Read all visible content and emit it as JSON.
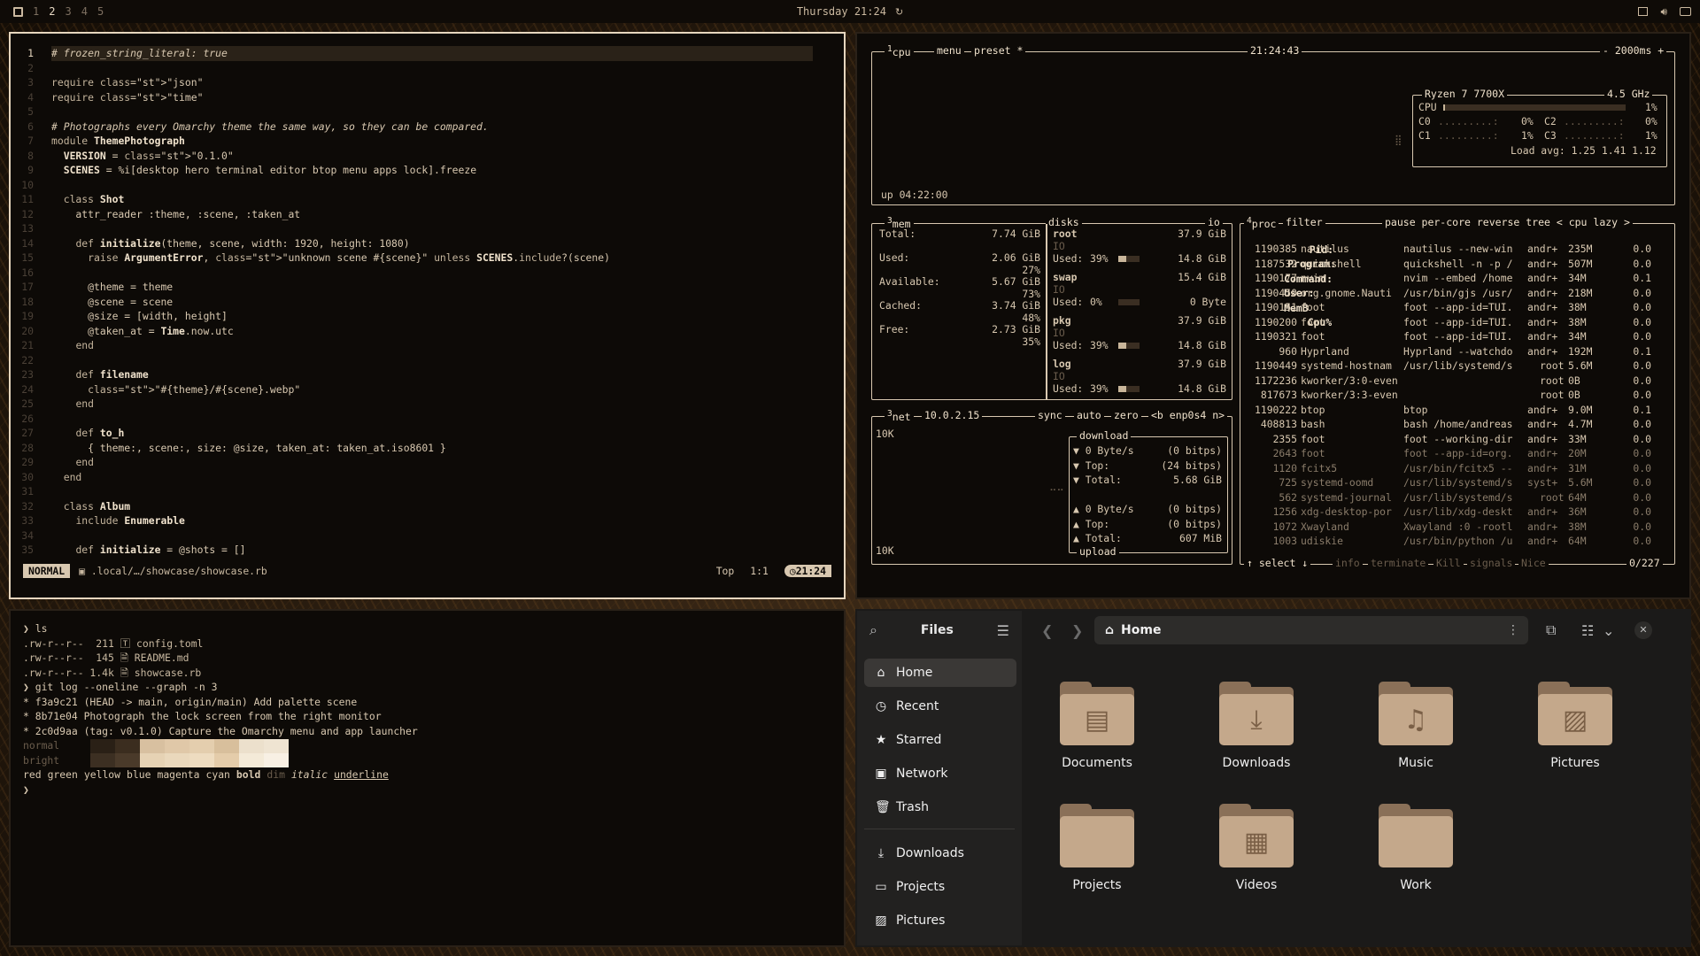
{
  "topbar": {
    "workspaces": [
      "1",
      "2",
      "3",
      "4",
      "5"
    ],
    "active_workspace": "2",
    "clock": "Thursday 21:24",
    "menu_icon": "omarchy-logo-icon",
    "right_icons": [
      "screen-icon",
      "volume-icon",
      "battery-icon"
    ]
  },
  "editor": {
    "lines": [
      {
        "n": "1",
        "t": "# frozen_string_literal: true"
      },
      {
        "n": "2",
        "t": ""
      },
      {
        "n": "3",
        "t": "require \"json\""
      },
      {
        "n": "4",
        "t": "require \"time\""
      },
      {
        "n": "5",
        "t": ""
      },
      {
        "n": "6",
        "t": "# Photographs every Omarchy theme the same way, so they can be compared."
      },
      {
        "n": "7",
        "t": "module ThemePhotograph"
      },
      {
        "n": "8",
        "t": "  VERSION = \"0.1.0\""
      },
      {
        "n": "9",
        "t": "  SCENES = %i[desktop hero terminal editor btop menu apps lock].freeze"
      },
      {
        "n": "10",
        "t": ""
      },
      {
        "n": "11",
        "t": "  class Shot"
      },
      {
        "n": "12",
        "t": "    attr_reader :theme, :scene, :taken_at"
      },
      {
        "n": "13",
        "t": ""
      },
      {
        "n": "14",
        "t": "    def initialize(theme, scene, width: 1920, height: 1080)"
      },
      {
        "n": "15",
        "t": "      raise ArgumentError, \"unknown scene #{scene}\" unless SCENES.include?(scene)"
      },
      {
        "n": "16",
        "t": ""
      },
      {
        "n": "17",
        "t": "      @theme = theme"
      },
      {
        "n": "18",
        "t": "      @scene = scene"
      },
      {
        "n": "19",
        "t": "      @size = [width, height]"
      },
      {
        "n": "20",
        "t": "      @taken_at = Time.now.utc"
      },
      {
        "n": "21",
        "t": "    end"
      },
      {
        "n": "22",
        "t": ""
      },
      {
        "n": "23",
        "t": "    def filename"
      },
      {
        "n": "24",
        "t": "      \"#{theme}/#{scene}.webp\""
      },
      {
        "n": "25",
        "t": "    end"
      },
      {
        "n": "26",
        "t": ""
      },
      {
        "n": "27",
        "t": "    def to_h"
      },
      {
        "n": "28",
        "t": "      { theme:, scene:, size: @size, taken_at: taken_at.iso8601 }"
      },
      {
        "n": "29",
        "t": "    end"
      },
      {
        "n": "30",
        "t": "  end"
      },
      {
        "n": "31",
        "t": ""
      },
      {
        "n": "32",
        "t": "  class Album"
      },
      {
        "n": "33",
        "t": "    include Enumerable"
      },
      {
        "n": "34",
        "t": ""
      },
      {
        "n": "35",
        "t": "    def initialize = @shots = []"
      }
    ],
    "status": {
      "mode": "NORMAL",
      "file": ".local/…/showcase/showcase.rb",
      "position": "Top",
      "cursor": "1:1",
      "clock": "21:24"
    }
  },
  "btop": {
    "cpu": {
      "title": "cpu",
      "menu": "menu",
      "preset": "preset *",
      "time": "21:24:43",
      "interval": "- 2000ms +",
      "model": "Ryzen 7 7700X",
      "freq": "4.5 GHz",
      "total_label": "CPU",
      "total": "1%",
      "cores": [
        {
          "name": "C0",
          "val": "0%"
        },
        {
          "name": "C1",
          "val": "1%"
        },
        {
          "name": "C2",
          "val": "0%"
        },
        {
          "name": "C3",
          "val": "1%"
        }
      ],
      "load": "Load avg: 1.25 1.41 1.12",
      "uptime": "up 04:22:00"
    },
    "mem": {
      "title": "mem",
      "rows": [
        {
          "l": "Total:",
          "v": "7.74 GiB"
        },
        {
          "l": "Used:",
          "v": "2.06 GiB",
          "p": "27%"
        },
        {
          "l": "Available:",
          "v": "5.67 GiB",
          "p": "73%"
        },
        {
          "l": "Cached:",
          "v": "3.74 GiB",
          "p": "48%"
        },
        {
          "l": "Free:",
          "v": "2.73 GiB",
          "p": "35%"
        }
      ]
    },
    "disks": {
      "title": "disks",
      "io": "io",
      "items": [
        {
          "name": "root",
          "size": "37.9 GiB",
          "used_pct": "39%",
          "used": "14.8 GiB"
        },
        {
          "name": "swap",
          "size": "15.4 GiB",
          "used_pct": "0%",
          "used": "0 Byte"
        },
        {
          "name": "pkg",
          "size": "37.9 GiB",
          "used_pct": "39%",
          "used": "14.8 GiB"
        },
        {
          "name": "log",
          "size": "37.9 GiB",
          "used_pct": "39%",
          "used": "14.8 GiB"
        }
      ],
      "io_label": "IO",
      "used_label": "Used:"
    },
    "net": {
      "title": "net",
      "addr": "10.0.2.15",
      "sync": "sync",
      "auto": "auto",
      "zero": "zero",
      "iface": "<b enp0s4 n>",
      "scale_top": "10K",
      "scale_bottom": "10K",
      "download": "download",
      "upload": "upload",
      "down": [
        {
          "l": "▼ 0 Byte/s",
          "r": "(0 bitps)"
        },
        {
          "l": "▼ Top:",
          "r": "(24 bitps)"
        },
        {
          "l": "▼ Total:",
          "r": "5.68 GiB"
        }
      ],
      "up": [
        {
          "l": "▲ 0 Byte/s",
          "r": "(0 bitps)"
        },
        {
          "l": "▲ Top:",
          "r": "(0 bitps)"
        },
        {
          "l": "▲ Total:",
          "r": "607 MiB"
        }
      ]
    },
    "proc": {
      "title": "proc",
      "filter": "filter",
      "opts": "pause per-core reverse tree < cpu lazy >",
      "headers": {
        "pid": "Pid:",
        "program": "Program:",
        "command": "Command:",
        "user": "User:",
        "mem": "MemB",
        "cpu": "Cpu%"
      },
      "rows": [
        [
          "1190385",
          "nautilus",
          "nautilus --new-win",
          "andr+",
          "235M",
          "0.0"
        ],
        [
          "1187532",
          "quickshell",
          "quickshell -n -p /",
          "andr+",
          "507M",
          "0.0"
        ],
        [
          "1190177",
          "nvim",
          "nvim --embed /home",
          "andr+",
          "34M",
          "0.1"
        ],
        [
          "1190450",
          "org.gnome.Nauti",
          "/usr/bin/gjs /usr/",
          "andr+",
          "218M",
          "0.0"
        ],
        [
          "1190151",
          "foot",
          "foot --app-id=TUI.",
          "andr+",
          "38M",
          "0.0"
        ],
        [
          "1190200",
          "foot",
          "foot --app-id=TUI.",
          "andr+",
          "38M",
          "0.0"
        ],
        [
          "1190321",
          "foot",
          "foot --app-id=TUI.",
          "andr+",
          "34M",
          "0.0"
        ],
        [
          "960",
          "Hyprland",
          "Hyprland --watchdo",
          "andr+",
          "192M",
          "0.1"
        ],
        [
          "1190449",
          "systemd-hostnam",
          "/usr/lib/systemd/s",
          "root",
          "5.6M",
          "0.0"
        ],
        [
          "1172236",
          "kworker/3:0-even",
          "",
          "root",
          "0B",
          "0.0"
        ],
        [
          "817673",
          "kworker/3:3-even",
          "",
          "root",
          "0B",
          "0.0"
        ],
        [
          "1190222",
          "btop",
          "btop",
          "andr+",
          "9.0M",
          "0.1"
        ],
        [
          "408813",
          "bash",
          "bash /home/andreas",
          "andr+",
          "4.7M",
          "0.0"
        ],
        [
          "2355",
          "foot",
          "foot --working-dir",
          "andr+",
          "33M",
          "0.0"
        ],
        [
          "2643",
          "foot",
          "foot --app-id=org.",
          "andr+",
          "20M",
          "0.0"
        ],
        [
          "1120",
          "fcitx5",
          "/usr/bin/fcitx5 --",
          "andr+",
          "31M",
          "0.0"
        ],
        [
          "725",
          "systemd-oomd",
          "/usr/lib/systemd/s",
          "syst+",
          "5.6M",
          "0.0"
        ],
        [
          "562",
          "systemd-journal",
          "/usr/lib/systemd/s",
          "root",
          "64M",
          "0.0"
        ],
        [
          "1256",
          "xdg-desktop-por",
          "/usr/lib/xdg-deskt",
          "andr+",
          "36M",
          "0.0"
        ],
        [
          "1072",
          "Xwayland",
          "Xwayland :0 -rootl",
          "andr+",
          "38M",
          "0.0"
        ],
        [
          "1003",
          "udiskie",
          "/usr/bin/python /u",
          "andr+",
          "64M",
          "0.0"
        ]
      ],
      "footer": {
        "select": "↑ select ↓",
        "info": "info",
        "terminate": "terminate",
        "kill": "Kill",
        "signals": "signals",
        "nice": "Nice",
        "count": "0/227"
      }
    }
  },
  "terminal": {
    "lines": [
      "❯ ls",
      ".rw-r--r--  211 🅃 config.toml",
      ".rw-r--r--  145 🗎 README.md",
      ".rw-r--r-- 1.4k 🗎 showcase.rb",
      "❯ git log --oneline --graph -n 3",
      "* f3a9c21 (HEAD -> main, origin/main) Add palette scene",
      "* 8b71e04 Photograph the lock screen from the right monitor",
      "* 2c0d9aa (tag: v0.1.0) Capture the Omarchy menu and app launcher"
    ],
    "palette_normal": "normal",
    "palette_bright": "bright",
    "normal_colors": [
      "#2a2016",
      "#3b2d1f",
      "#d8c0a0",
      "#e0c8a8",
      "#e4ceae",
      "#d8bf9c",
      "#ece0cc",
      "#efe4d2"
    ],
    "bright_colors": [
      "#3c2f22",
      "#4a3a2a",
      "#e6d2b4",
      "#ead8bc",
      "#eedcc0",
      "#e4ccaa",
      "#f4ead8",
      "#f8f0e4"
    ],
    "styles": [
      "red",
      "green",
      "yellow",
      "blue",
      "magenta",
      "cyan",
      "bold",
      "dim",
      "italic",
      "underline"
    ],
    "prompt": "❯"
  },
  "files": {
    "title": "Files",
    "path": "Home",
    "sidebar": [
      {
        "icon": "home-icon",
        "label": "Home"
      },
      {
        "icon": "clock-icon",
        "label": "Recent"
      },
      {
        "icon": "star-icon",
        "label": "Starred"
      },
      {
        "icon": "network-icon",
        "label": "Network"
      },
      {
        "icon": "trash-icon",
        "label": "Trash"
      },
      {
        "icon": "download-icon",
        "label": "Downloads"
      },
      {
        "icon": "folder-icon",
        "label": "Projects"
      },
      {
        "icon": "image-icon",
        "label": "Pictures"
      }
    ],
    "folders": [
      {
        "label": "Documents",
        "icon": "document-icon"
      },
      {
        "label": "Downloads",
        "icon": "download-icon"
      },
      {
        "label": "Music",
        "icon": "music-icon"
      },
      {
        "label": "Pictures",
        "icon": "image-icon"
      },
      {
        "label": "Projects",
        "icon": "folder-icon"
      },
      {
        "label": "Videos",
        "icon": "film-icon"
      },
      {
        "label": "Work",
        "icon": "folder-icon"
      }
    ]
  }
}
